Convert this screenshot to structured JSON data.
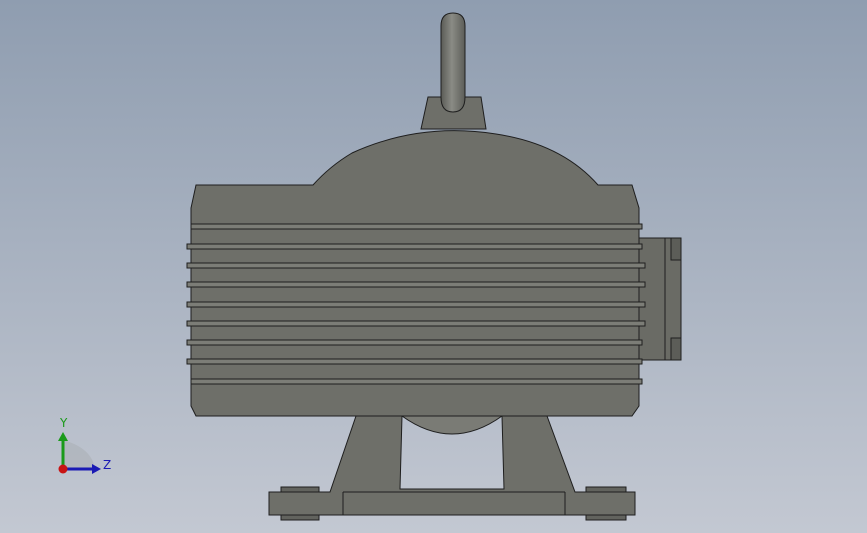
{
  "viewport": {
    "background_top": "#8f9db0",
    "background_bottom": "#c3c8d2"
  },
  "model": {
    "body_color": "#6e6f69",
    "shade_color": "#5a5b56",
    "edge_color": "#1e1e1e"
  },
  "triad": {
    "y_label": "Y",
    "z_label": "Z",
    "y_color": "#1a9a1a",
    "z_color": "#1a1ab4",
    "x_color": "#c81414"
  }
}
